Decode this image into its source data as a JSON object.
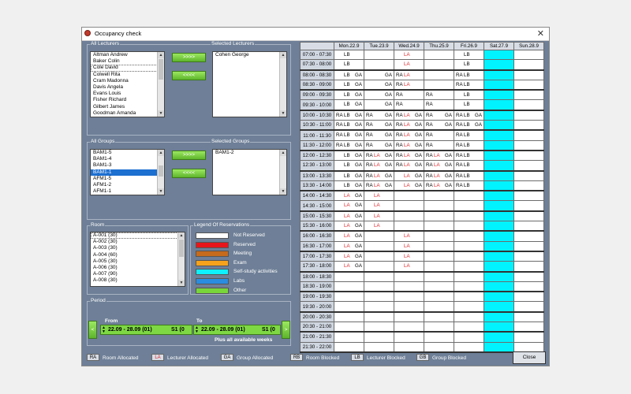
{
  "window": {
    "title": "Occupancy check",
    "close_glyph": "✕"
  },
  "lecturers": {
    "label": "All Lecturers",
    "items": [
      "Altman Andrew",
      "Baker Colin",
      "Cole David",
      "Colwell Rita",
      "Cram Madonna",
      "Davis Angela",
      "Evans Louis",
      "Fisher Richard",
      "Gilbert James",
      "Goodman Amanda"
    ],
    "selected_label": "Selected Lecturers",
    "selected_items": [
      "Cohen George"
    ]
  },
  "groups": {
    "label": "All Groups",
    "items": [
      "BAM1-5",
      "BAM1-4",
      "BAM1-3",
      "BAM1-1",
      "AFM1-5",
      "AFM1-2",
      "AFM1-1"
    ],
    "selected_label": "Selected Groups",
    "selected_items": [
      "BAM1-2"
    ]
  },
  "buttons": {
    "add": ">>>>",
    "remove": "<<<<",
    "close": "Close"
  },
  "room": {
    "label": "Room",
    "items": [
      "A-001 (30)",
      "A-002 (30)",
      "A-003 (30)",
      "A-004 (60)",
      "A-005 (30)",
      "A-006 (30)",
      "A-007 (90)",
      "A-008 (30)"
    ]
  },
  "legend": {
    "label": "Legend Of Reservations",
    "items": [
      {
        "label": "Not Reserved",
        "color": "#ffffff"
      },
      {
        "label": "Reserved",
        "color": "#e8161b"
      },
      {
        "label": "Meeting",
        "color": "#c66a1c"
      },
      {
        "label": "Exam",
        "color": "#f6a21b"
      },
      {
        "label": "Self-study activities",
        "color": "#0ff0ff"
      },
      {
        "label": "Labs",
        "color": "#2a8de0"
      },
      {
        "label": "Other",
        "color": "#78d63a"
      }
    ]
  },
  "period": {
    "label": "Period",
    "from_label": "From",
    "to_label": "To",
    "from_value": "22.09 - 28.09 (01)",
    "to_value": "22.09 - 28.09 (01)",
    "from_code": "S1 (0",
    "to_code": "S1 (0",
    "note": "Plus all available weeks",
    "prev": "<",
    "next": ">"
  },
  "schedule": {
    "days": [
      "Mon.22.9",
      "Tue.23.9",
      "Wed.24.9",
      "Thu.25.9",
      "Fri.26.9",
      "Sat.27.9",
      "Sun.28.9"
    ],
    "times": [
      "07:00 - 07:30",
      "07:30 - 08:00",
      "08:00 - 08:30",
      "08:30 - 09:00",
      "09:00 - 09:30",
      "09:30 - 10:00",
      "10:00 - 10:30",
      "10:30 - 11:00",
      "11:00 - 11:30",
      "11:30 - 12:00",
      "12:00 - 12:30",
      "12:30 - 13:00",
      "13:00 - 13:30",
      "13:30 - 14:00",
      "14:00 - 14:30",
      "14:30 - 15:00",
      "15:00 - 15:30",
      "15:30 - 16:00",
      "16:00 - 16:30",
      "16:30 - 17:00",
      "17:00 - 17:30",
      "17:30 - 18:00",
      "18:00 - 18:30",
      "18:30 - 19:00",
      "19:00 - 19:30",
      "19:30 - 20:00",
      "20:00 - 20:30",
      "20:30 - 21:00",
      "21:00 - 21:30",
      "21:30 - 22:00"
    ],
    "rows": [
      [
        [
          "LB"
        ],
        [],
        [
          "LA"
        ],
        [],
        [
          "LB"
        ]
      ],
      [
        [
          "LB"
        ],
        [],
        [
          "LA"
        ],
        [],
        [
          "LB"
        ]
      ],
      [
        [
          "LB",
          "GA"
        ],
        [
          "GA"
        ],
        [
          "RA",
          "LA"
        ],
        [],
        [
          "RA",
          "LB"
        ]
      ],
      [
        [
          "LB",
          "GA"
        ],
        [
          "GA"
        ],
        [
          "RA",
          "LA"
        ],
        [],
        [
          "RA",
          "LB"
        ]
      ],
      [
        [
          "LB",
          "GA"
        ],
        [
          "GA"
        ],
        [
          "RA"
        ],
        [
          "RA"
        ],
        [
          "LB"
        ]
      ],
      [
        [
          "LB",
          "GA"
        ],
        [
          "GA"
        ],
        [
          "RA"
        ],
        [
          "RA"
        ],
        [
          "LB"
        ]
      ],
      [
        [
          "RA",
          "LB",
          "GA"
        ],
        [
          "RA",
          "GA"
        ],
        [
          "RA",
          "LA",
          "GA"
        ],
        [
          "RA",
          "GA"
        ],
        [
          "RA",
          "LB",
          "GA"
        ]
      ],
      [
        [
          "RA",
          "LB",
          "GA"
        ],
        [
          "RA",
          "GA"
        ],
        [
          "RA",
          "LA",
          "GA"
        ],
        [
          "RA",
          "GA"
        ],
        [
          "RA",
          "LB",
          "GA"
        ]
      ],
      [
        [
          "RA",
          "LB",
          "GA"
        ],
        [
          "RA",
          "GA"
        ],
        [
          "RA",
          "LA",
          "GA"
        ],
        [
          "RA"
        ],
        [
          "RA",
          "LB"
        ]
      ],
      [
        [
          "RA",
          "LB",
          "GA"
        ],
        [
          "RA",
          "GA"
        ],
        [
          "RA",
          "LA",
          "GA"
        ],
        [
          "RA"
        ],
        [
          "RA",
          "LB"
        ]
      ],
      [
        [
          "LB",
          "GA"
        ],
        [
          "RA",
          "LA",
          "GA"
        ],
        [
          "RA",
          "LA",
          "GA"
        ],
        [
          "RA",
          "LA",
          "GA"
        ],
        [
          "RA",
          "LB"
        ]
      ],
      [
        [
          "LB",
          "GA"
        ],
        [
          "RA",
          "LA",
          "GA"
        ],
        [
          "RA",
          "LA",
          "GA"
        ],
        [
          "RA",
          "LA",
          "GA"
        ],
        [
          "RA",
          "LB"
        ]
      ],
      [
        [
          "LB",
          "GA"
        ],
        [
          "RA",
          "LA",
          "GA"
        ],
        [
          "LA",
          "GA"
        ],
        [
          "RA",
          "LA",
          "GA"
        ],
        [
          "RA",
          "LB"
        ]
      ],
      [
        [
          "LB",
          "GA"
        ],
        [
          "RA",
          "LA",
          "GA"
        ],
        [
          "LA",
          "GA"
        ],
        [
          "RA",
          "LA",
          "GA"
        ],
        [
          "RA",
          "LB"
        ]
      ],
      [
        [
          "LA",
          "GA"
        ],
        [
          "LA"
        ],
        [],
        [],
        []
      ],
      [
        [
          "LA",
          "GA"
        ],
        [
          "LA"
        ],
        [],
        [],
        []
      ],
      [
        [
          "LA",
          "GA"
        ],
        [
          "LA"
        ],
        [],
        [],
        []
      ],
      [
        [
          "LA",
          "GA"
        ],
        [
          "LA"
        ],
        [],
        [],
        []
      ],
      [
        [
          "LA",
          "GA"
        ],
        [],
        [
          "LA"
        ],
        [],
        []
      ],
      [
        [
          "LA",
          "GA"
        ],
        [],
        [
          "LA"
        ],
        [],
        []
      ],
      [
        [
          "LA",
          "GA"
        ],
        [],
        [
          "LA"
        ],
        [],
        []
      ],
      [
        [
          "LA",
          "GA"
        ],
        [],
        [
          "LA"
        ],
        [],
        []
      ],
      [
        [],
        [],
        [],
        [],
        []
      ],
      [
        [],
        [],
        [],
        [],
        []
      ],
      [
        [],
        [],
        [],
        [],
        []
      ],
      [
        [],
        [],
        [],
        [],
        []
      ],
      [
        [],
        [],
        [],
        [],
        []
      ],
      [
        [],
        [],
        [],
        [],
        []
      ],
      [
        [],
        [],
        [],
        [],
        []
      ],
      [
        [],
        [],
        [],
        [],
        []
      ]
    ]
  },
  "bottom_legend": [
    {
      "code": "RA",
      "label": "Room Allocated"
    },
    {
      "code": "LA",
      "label": "Lecturer Allocated"
    },
    {
      "code": "GA",
      "label": "Group Allocated"
    },
    {
      "code": "RB",
      "label": "Room Blocked"
    },
    {
      "code": "LB",
      "label": "Lecturer Blocked"
    },
    {
      "code": "GB",
      "label": "Group Blocked"
    }
  ]
}
